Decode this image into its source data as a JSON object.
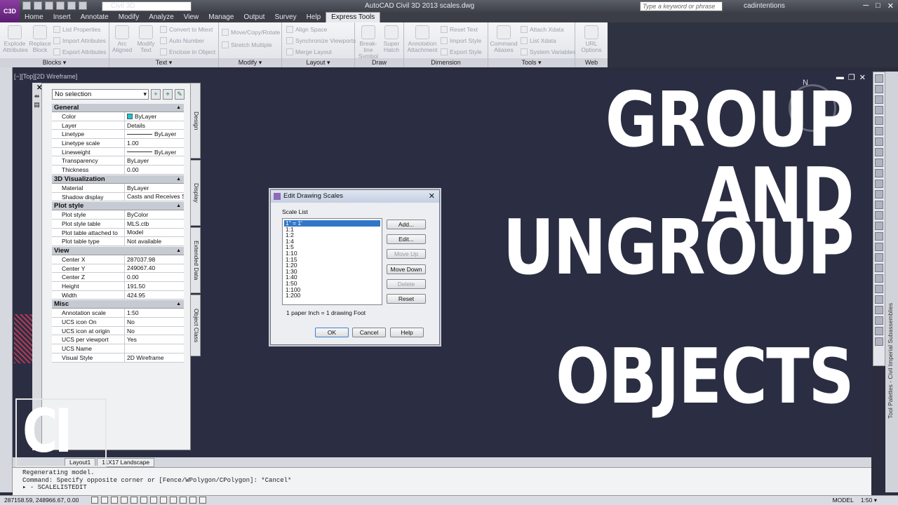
{
  "app": {
    "logo_text": "C3D",
    "workspace": "Civil 3D",
    "title": "AutoCAD Civil 3D 2013    scales.dwg",
    "search_placeholder": "Type a keyword or phrase",
    "user": "cadintentions"
  },
  "menu": {
    "tabs": [
      "Home",
      "Insert",
      "Annotate",
      "Modify",
      "Analyze",
      "View",
      "Manage",
      "Output",
      "Survey",
      "Help",
      "Express Tools"
    ],
    "active": "Express Tools"
  },
  "ribbon": {
    "blocks": {
      "title": "Blocks ▾",
      "explode": "Explode Attributes",
      "replace": "Replace Block",
      "list_props": "List Properties",
      "import_attr": "Import Attributes",
      "export_attr": "Export Attributes"
    },
    "text": {
      "title": "Text ▾",
      "arc": "Arc Aligned",
      "modify": "Modify Text",
      "convert": "Convert to Mtext",
      "auto_number": "Auto Number",
      "enclose": "Enclose in Object"
    },
    "modify": {
      "title": "Modify ▾",
      "move_copy": "Move/Copy/Rotate",
      "stretch": "Stretch Multiple"
    },
    "layout": {
      "title": "Layout ▾",
      "align": "Align Space",
      "sync": "Synchronize Viewports",
      "merge": "Merge Layout"
    },
    "draw": {
      "title": "Draw",
      "breakline": "Break-line Symbol",
      "hatch": "Super Hatch"
    },
    "dimension": {
      "title": "Dimension",
      "annotation": "Annotation Attachment",
      "reset": "Reset Text",
      "import_style": "Import Style",
      "export_style": "Export Style"
    },
    "tools": {
      "title": "Tools ▾",
      "command_aliases": "Command Aliases",
      "attach_xdata": "Attach Xdata",
      "list_xdata": "List Xdata",
      "sysvars": "System Variables"
    },
    "web": {
      "title": "Web",
      "url": "URL Options"
    }
  },
  "viewport": {
    "label": "[−][Top][2D Wireframe]",
    "compass_n": "N"
  },
  "properties": {
    "selection": "No selection",
    "sections": [
      {
        "title": "General",
        "rows": [
          [
            "Color",
            "ByLayer"
          ],
          [
            "Layer",
            "Details"
          ],
          [
            "Linetype",
            "ByLayer"
          ],
          [
            "Linetype scale",
            "1.00"
          ],
          [
            "Lineweight",
            "ByLayer"
          ],
          [
            "Transparency",
            "ByLayer"
          ],
          [
            "Thickness",
            "0.00"
          ]
        ]
      },
      {
        "title": "3D Visualization",
        "rows": [
          [
            "Material",
            "ByLayer"
          ],
          [
            "Shadow display",
            "Casts and Receives S..."
          ]
        ]
      },
      {
        "title": "Plot style",
        "rows": [
          [
            "Plot style",
            "ByColor"
          ],
          [
            "Plot style table",
            "MLS.ctb"
          ],
          [
            "Plot table attached to",
            "Model"
          ],
          [
            "Plot table type",
            "Not available"
          ]
        ]
      },
      {
        "title": "View",
        "rows": [
          [
            "Center X",
            "287037.98"
          ],
          [
            "Center Y",
            "249067.40"
          ],
          [
            "Center Z",
            "0.00"
          ],
          [
            "Height",
            "191.50"
          ],
          [
            "Width",
            "424.95"
          ]
        ]
      },
      {
        "title": "Misc",
        "rows": [
          [
            "Annotation scale",
            "1:50"
          ],
          [
            "UCS icon On",
            "No"
          ],
          [
            "UCS icon at origin",
            "No"
          ],
          [
            "UCS per viewport",
            "Yes"
          ],
          [
            "UCS Name",
            ""
          ],
          [
            "Visual Style",
            "2D Wireframe"
          ]
        ]
      }
    ],
    "tabs": [
      "Design",
      "Display",
      "Extended Data",
      "Object Class"
    ]
  },
  "dialog": {
    "title": "Edit Drawing Scales",
    "list_label": "Scale List",
    "scales": [
      "1\" = 1'",
      "1:1",
      "1:2",
      "1:4",
      "1:5",
      "1:10",
      "1:15",
      "1:20",
      "1:30",
      "1:40",
      "1:50",
      "1:100",
      "1:200"
    ],
    "selected": "1\" = 1'",
    "note": "1 paper Inch = 1 drawing Foot",
    "buttons": {
      "add": "Add...",
      "edit": "Edit...",
      "move_up": "Move Up",
      "move_down": "Move Down",
      "delete": "Delete",
      "reset": "Reset",
      "ok": "OK",
      "cancel": "Cancel",
      "help": "Help"
    }
  },
  "headline": [
    "GROUP AND",
    "UNGROUP",
    "OBJECTS"
  ],
  "layout_tabs": [
    "Layout1",
    "11X17 Landscape"
  ],
  "command_line": [
    "Regenerating model.",
    "Command: Specify opposite corner or [Fence/WPolygon/CPolygon]: *Cancel*",
    "▸ - SCALELISTEDIT"
  ],
  "status": {
    "coords": "287158.59, 248966.67, 0.00",
    "model": "MODEL",
    "scale": "1:50 ▾"
  },
  "tool_palette_label": "Tool Palettes - Civil Imperial Subassemblies",
  "brand": "CI"
}
